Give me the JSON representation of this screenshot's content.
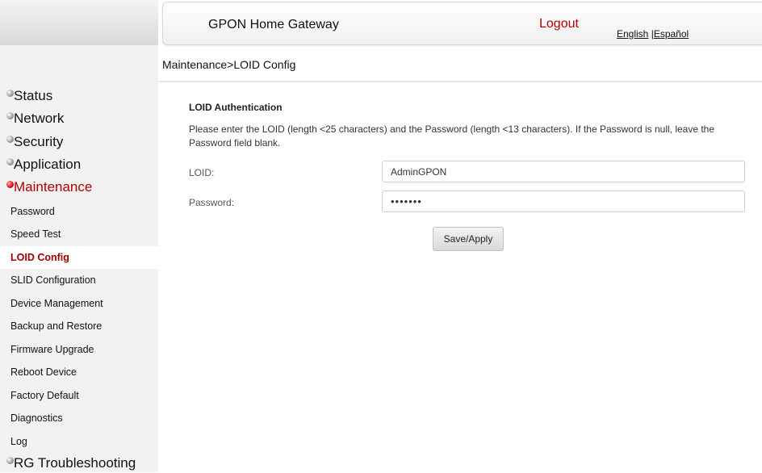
{
  "header": {
    "title": "GPON Home Gateway",
    "logout_label": "Logout",
    "lang_english": "English",
    "lang_separator": "|",
    "lang_spanish": "Español"
  },
  "breadcrumb": "Maintenance>LOID Config",
  "sidebar": {
    "main_items": [
      {
        "label": "Status"
      },
      {
        "label": "Network"
      },
      {
        "label": "Security"
      },
      {
        "label": "Application"
      },
      {
        "label": "Maintenance",
        "active": true
      }
    ],
    "sub_items": [
      {
        "label": "Password"
      },
      {
        "label": "Speed Test"
      },
      {
        "label": "LOID Config",
        "active": true
      },
      {
        "label": "SLID Configuration"
      },
      {
        "label": "Device Management"
      },
      {
        "label": "Backup and Restore"
      },
      {
        "label": "Firmware Upgrade"
      },
      {
        "label": "Reboot Device"
      },
      {
        "label": "Factory Default"
      },
      {
        "label": "Diagnostics"
      },
      {
        "label": "Log"
      }
    ],
    "last_item": {
      "label": "RG Troubleshooting"
    }
  },
  "content": {
    "section_title": "LOID Authentication",
    "instructions": "Please enter the LOID (length <25 characters) and the Password (length <13 characters). If the Password is null, leave the Password field blank.",
    "loid_label": "LOID:",
    "loid_value": "AdminGPON",
    "password_label": "Password:",
    "password_value": "•••••••",
    "save_label": "Save/Apply"
  },
  "colors": {
    "accent_red": "#b00000",
    "sidebar_bg": "#f2f2f2"
  }
}
